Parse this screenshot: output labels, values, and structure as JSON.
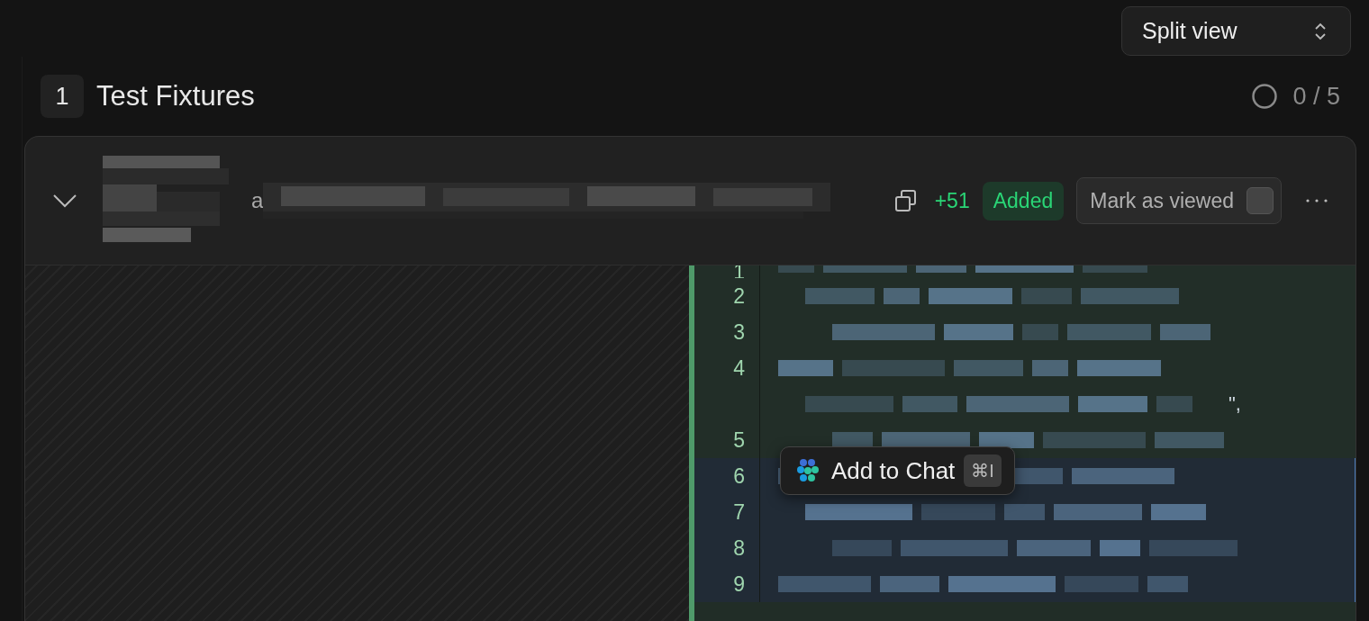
{
  "view_select": {
    "value": "Split view"
  },
  "section": {
    "number": "1",
    "title": "Test Fixtures",
    "progress": "0 / 5"
  },
  "file": {
    "expanded": true,
    "path_visible": "a",
    "additions": "+51",
    "status": "Added",
    "mark_viewed": {
      "label": "Mark as viewed",
      "checked": false
    }
  },
  "diff": {
    "lines": [
      {
        "number": "1",
        "selected": false
      },
      {
        "number": "2",
        "selected": false
      },
      {
        "number": "3",
        "selected": false
      },
      {
        "number": "4",
        "selected": false
      },
      {
        "selected": false,
        "tail": "\","
      },
      {
        "number": "5",
        "selected": false
      },
      {
        "number": "6",
        "selected": true
      },
      {
        "number": "7",
        "selected": true
      },
      {
        "number": "8",
        "selected": true
      },
      {
        "number": "9",
        "selected": true
      }
    ]
  },
  "tooltip": {
    "label": "Add to Chat",
    "shortcut": "⌘I"
  }
}
